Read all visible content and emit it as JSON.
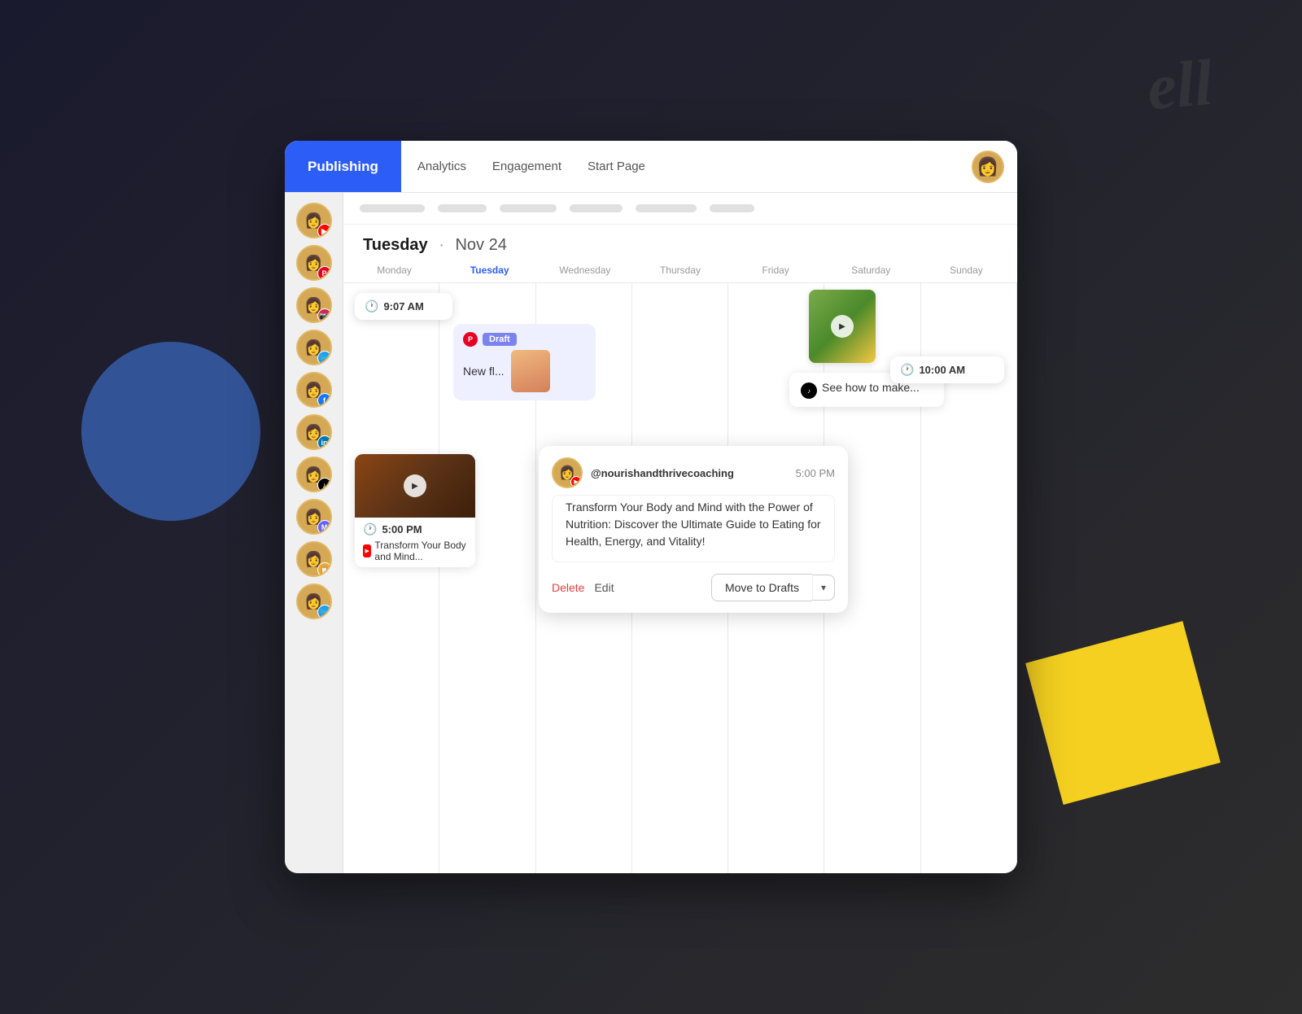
{
  "header": {
    "publishing_label": "Publishing",
    "nav_items": [
      {
        "label": "Analytics",
        "active": false
      },
      {
        "label": "Engagement",
        "active": false
      },
      {
        "label": "Start Page",
        "active": false
      }
    ]
  },
  "date": {
    "day": "Tuesday",
    "separator": "·",
    "month_day": "Nov 24"
  },
  "calendar": {
    "day_headers": [
      "Monday",
      "Tuesday",
      "Wednesday",
      "Thursday",
      "Friday",
      "Saturday",
      "Sunday"
    ],
    "active_day": "Tuesday"
  },
  "events": {
    "monday_time": "9:07 AM",
    "draft_badge": "Draft",
    "draft_text": "New fl...",
    "monday_video_time": "5:00 PM",
    "monday_video_caption": "Transform Your Body and Mind...",
    "friday_tiktok_text": "See how to make...",
    "saturday_time": "10:00 AM",
    "popup_username": "@nourishandthrivecoaching",
    "popup_time": "5:00 PM",
    "popup_body": "Transform Your Body and Mind with the Power of Nutrition: Discover the Ultimate Guide to Eating for Health, Energy, and Vitality!",
    "popup_delete": "Delete",
    "popup_edit": "Edit",
    "popup_draft_btn": "Move to Drafts"
  },
  "sidebar": {
    "accounts": [
      {
        "platform": "youtube",
        "badge_class": "badge-youtube"
      },
      {
        "platform": "pinterest",
        "badge_class": "badge-pinterest"
      },
      {
        "platform": "instagram",
        "badge_class": "badge-instagram"
      },
      {
        "platform": "twitter",
        "badge_class": "badge-twitter"
      },
      {
        "platform": "facebook",
        "badge_class": "badge-facebook"
      },
      {
        "platform": "linkedin",
        "badge_class": "badge-linkedin"
      },
      {
        "platform": "tiktok",
        "badge_class": "badge-tiktok"
      },
      {
        "platform": "mastodon",
        "badge_class": "badge-mastodon"
      },
      {
        "platform": "clipboard",
        "badge_class": "badge-clipboard"
      },
      {
        "platform": "twitter2",
        "badge_class": "badge-twitter2"
      }
    ]
  }
}
